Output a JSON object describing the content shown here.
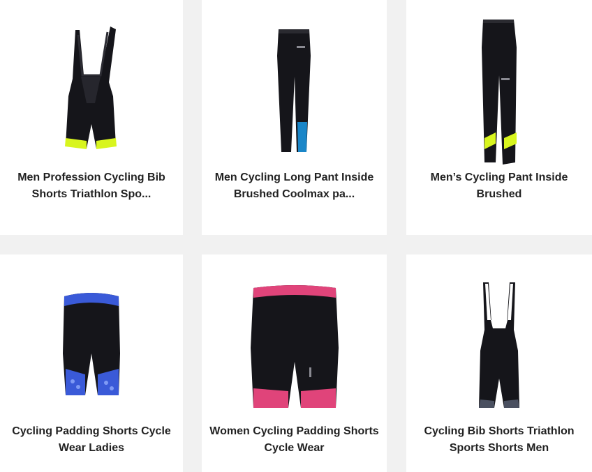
{
  "products": [
    {
      "title": "Men Profession Cycling Bib Shorts Triathlon Spo...",
      "image": "black-bib-shorts-yellow-hem"
    },
    {
      "title": "Men Cycling Long Pant Inside Brushed Coolmax pa...",
      "image": "black-long-pant-blue-panel"
    },
    {
      "title": "Men’s Cycling Pant Inside Brushed",
      "image": "black-long-pant-yellow-ankle"
    },
    {
      "title": "Cycling Padding Shorts Cycle Wear Ladies",
      "image": "black-shorts-blue-pattern"
    },
    {
      "title": "Women Cycling Padding Shorts Cycle Wear",
      "image": "black-shorts-pink-trim"
    },
    {
      "title": "Cycling Bib Shorts Triathlon Sports Shorts Men",
      "image": "black-bib-shorts-white-straps"
    }
  ],
  "colors": {
    "garment": "#15151a",
    "neon": "#d8f51e",
    "blue": "#1a86c8",
    "pink": "#e0447a",
    "pattern_blue": "#3a5ad8",
    "strap_white": "#ffffff",
    "grey_hem": "#4a5060"
  }
}
